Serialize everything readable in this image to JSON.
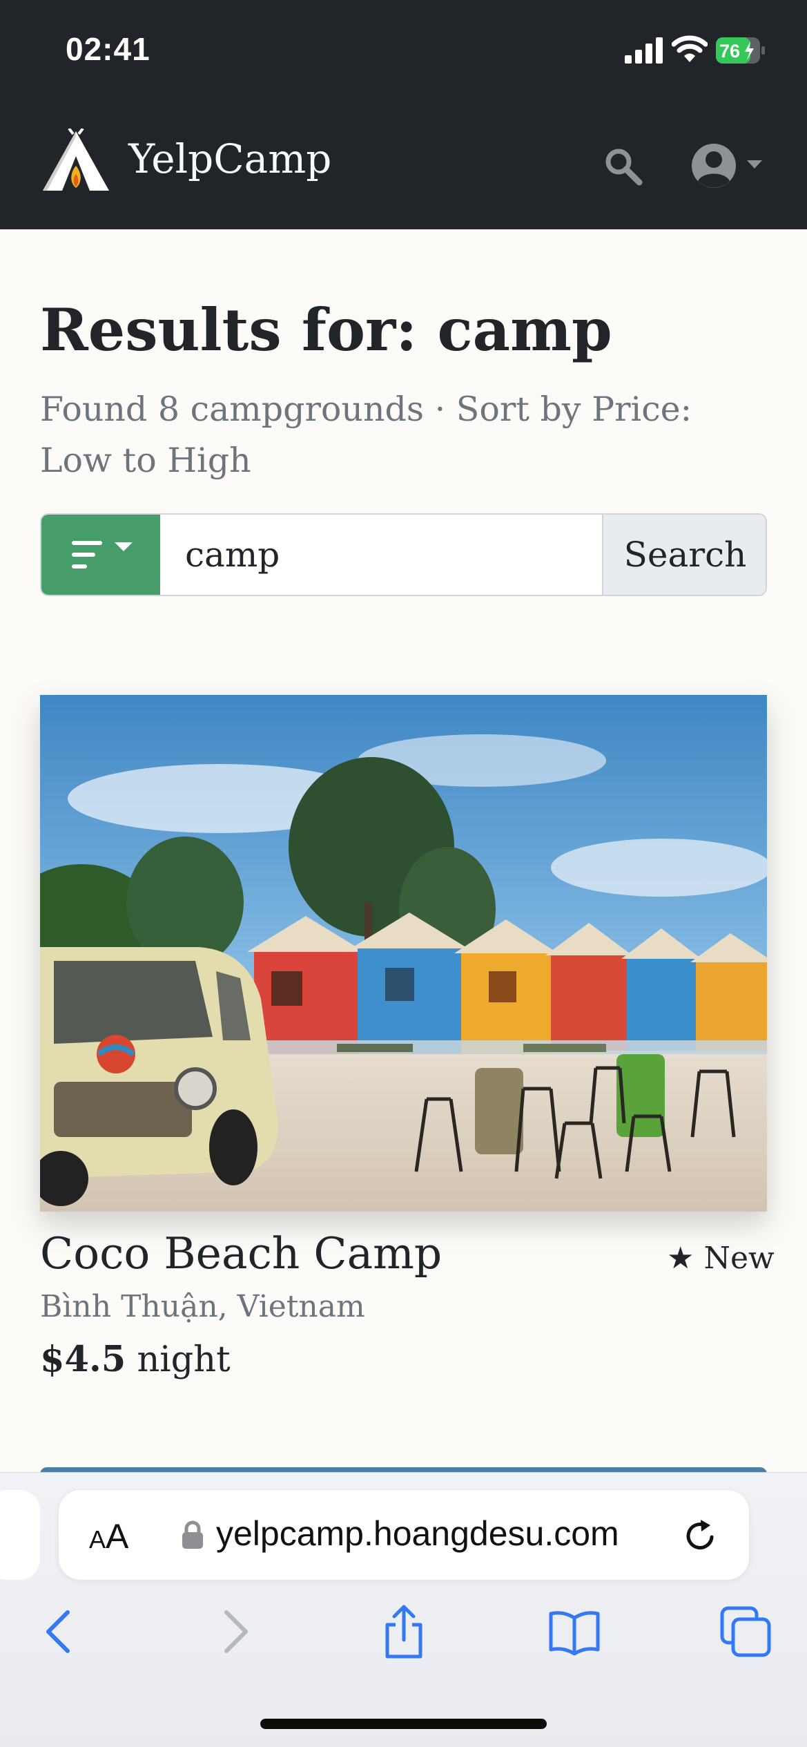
{
  "status_bar": {
    "time": "02:41",
    "battery": "76"
  },
  "navbar": {
    "brand": "YelpCamp"
  },
  "results": {
    "title": "Results for: camp",
    "subtitle": "Found 8 campgrounds · Sort by Price: Low to High"
  },
  "search": {
    "value": "camp",
    "button_label": "Search"
  },
  "campgrounds": [
    {
      "name": "Coco Beach Camp",
      "badge": "New",
      "location": "Bình Thuận, Vietnam",
      "price": "$4.5",
      "price_unit": "night"
    }
  ],
  "browser": {
    "text_size_small": "A",
    "text_size_large": "A",
    "url": "yelpcamp.hoangdesu.com"
  },
  "colors": {
    "navbar": "#212529",
    "sort_button": "#479d69",
    "page_background": "#fcfbf8",
    "muted_text": "#6c757d",
    "browser_blue": "#3478f6"
  },
  "icons": {
    "brand": "tent-fire-icon",
    "nav_search": "search-icon",
    "nav_user": "user-circle-icon",
    "sort": "sort-icon",
    "badge": "star-icon",
    "url_lock": "lock-icon",
    "reload": "reload-icon",
    "back": "chevron-left-icon",
    "forward": "chevron-right-icon",
    "share": "share-icon",
    "bookmarks": "book-icon",
    "tabs": "tabs-icon"
  }
}
